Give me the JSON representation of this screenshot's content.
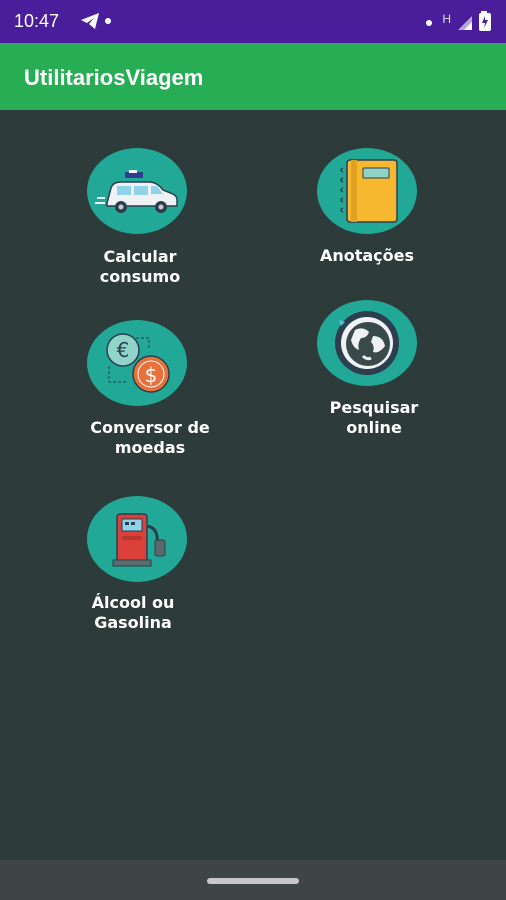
{
  "status_bar": {
    "time": "10:47",
    "network_indicator": "H",
    "icons": [
      "telegram-icon",
      "notification-dot-icon",
      "signal-icon",
      "battery-icon"
    ]
  },
  "app_bar": {
    "title": "UtilitariosViagem"
  },
  "tiles": [
    {
      "label": "Calcular\nconsumo",
      "icon": "car-icon"
    },
    {
      "label": "Anotações",
      "icon": "notebook-icon"
    },
    {
      "label": "Conversor de\nmoedas",
      "icon": "currency-exchange-icon"
    },
    {
      "label": "Pesquisar\nonline",
      "icon": "globe-icon"
    },
    {
      "label": "Álcool ou\nGasolina",
      "icon": "fuel-pump-icon"
    }
  ],
  "colors": {
    "status_bar": "#4a1e9a",
    "app_bar": "#27ae55",
    "background": "#2d3b3a",
    "icon_circle": "#22a896"
  }
}
